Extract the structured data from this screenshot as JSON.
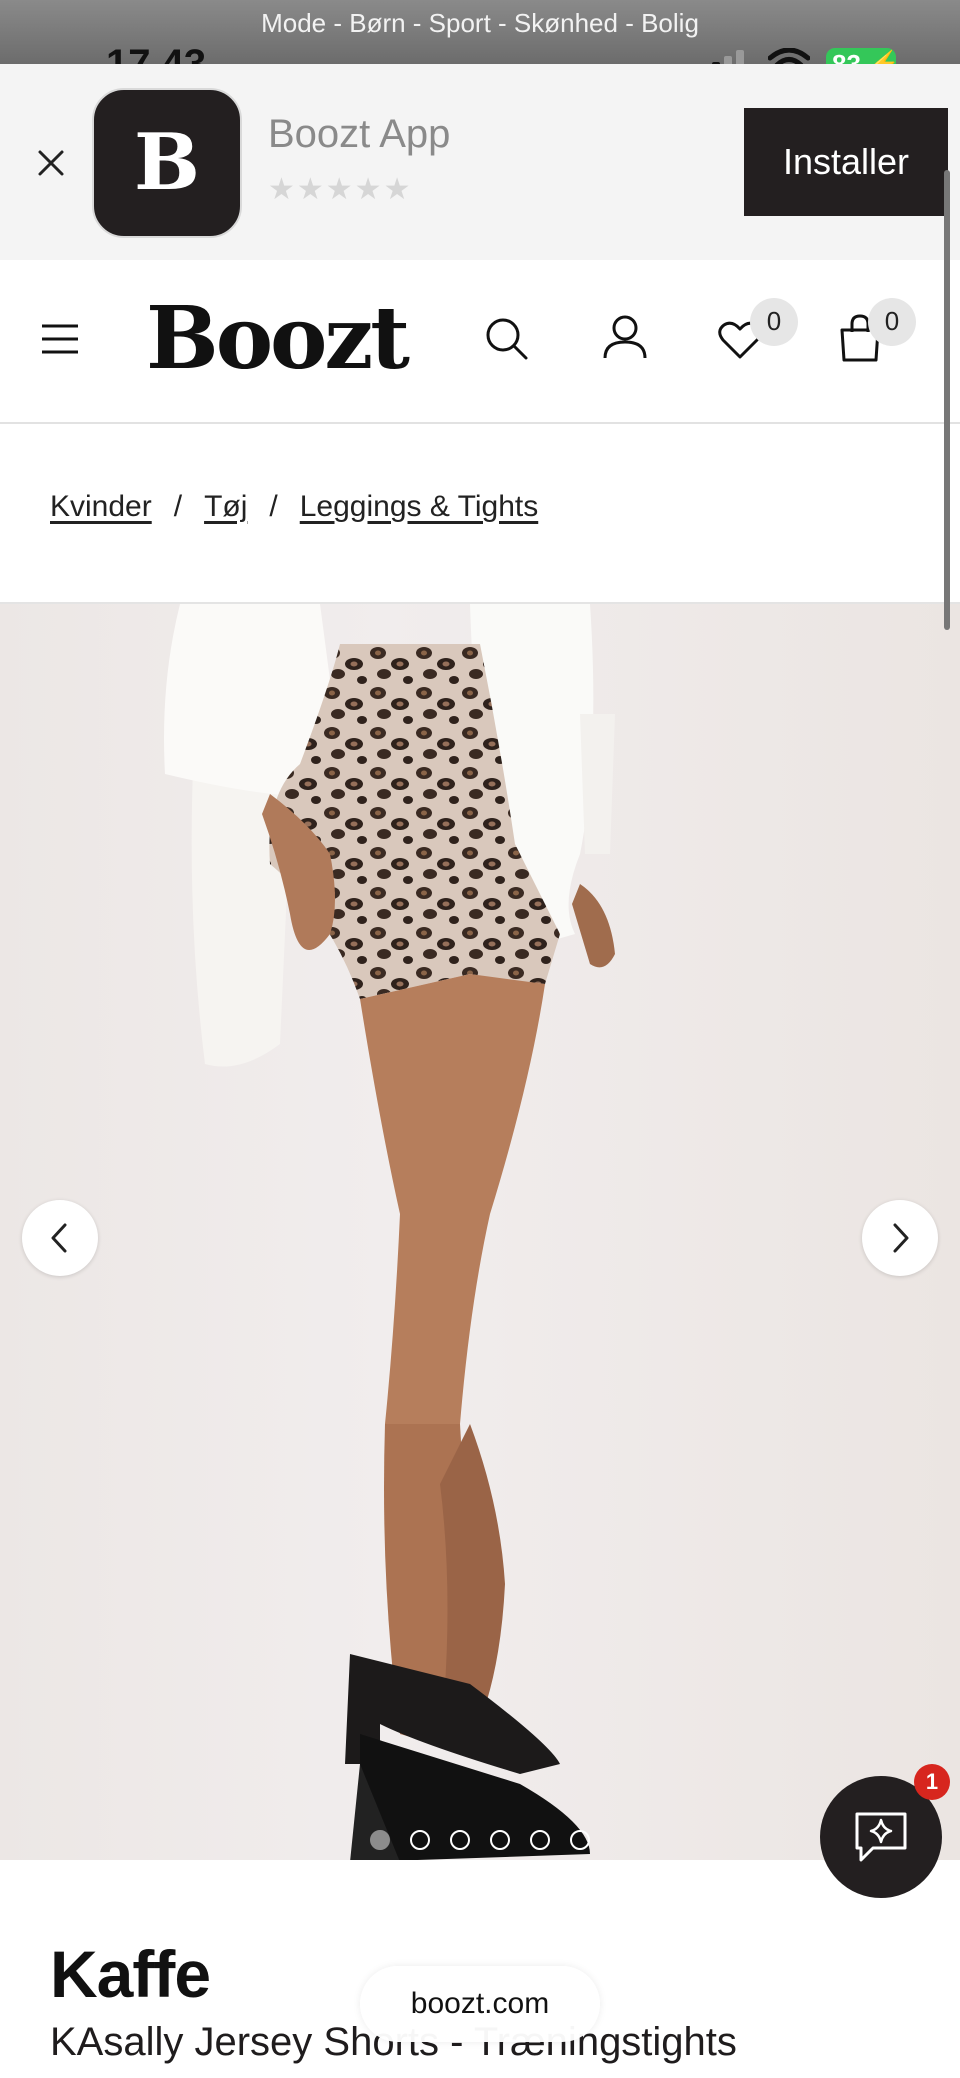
{
  "status_bar": {
    "url_banner": "Mode - Børn - Sport - Skønhed - Bolig",
    "time": "17.43",
    "battery": "83"
  },
  "app_banner": {
    "app_name": "Boozt App",
    "icon_letter": "B",
    "rating_stars": "★★★★★",
    "install_label": "Installer"
  },
  "header": {
    "logo": "Boozt",
    "wishlist_count": "0",
    "cart_count": "0"
  },
  "breadcrumb": {
    "items": [
      "Kvinder",
      "Tøj",
      "Leggings & Tights"
    ],
    "separator": "/"
  },
  "gallery": {
    "image_count": 6,
    "active_index": 0
  },
  "chat": {
    "badge": "1"
  },
  "product": {
    "brand": "Kaffe",
    "name": "KAsally Jersey Shorts - Træningstights"
  },
  "browser": {
    "url": "boozt.com"
  },
  "colors": {
    "dark": "#231f20",
    "badge_red": "#d7261e",
    "battery_green": "#34c759"
  },
  "icons": [
    "close-icon",
    "hamburger-icon",
    "search-icon",
    "user-icon",
    "heart-icon",
    "bag-icon",
    "chevron-left-icon",
    "chevron-right-icon",
    "chat-sparkle-icon"
  ]
}
